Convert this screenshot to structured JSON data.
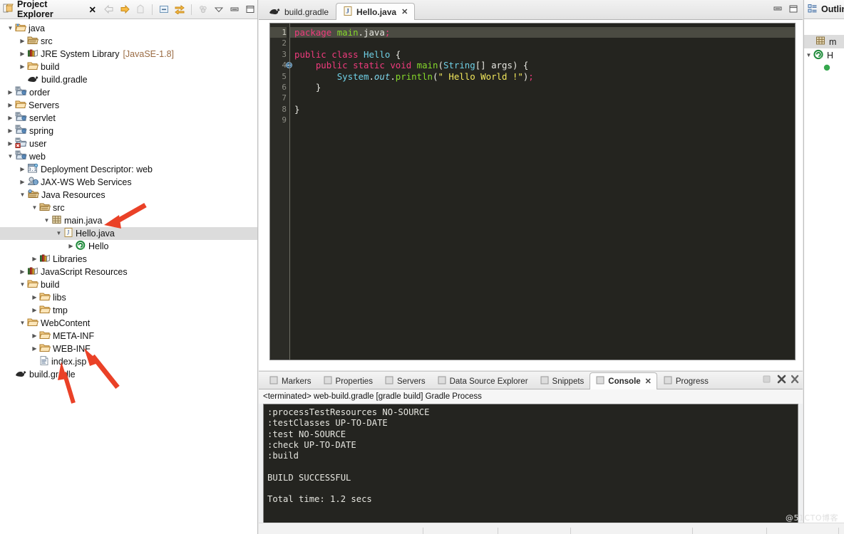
{
  "colors": {
    "accent_red": "#ea4127",
    "selection_gray": "#dcdcdc",
    "editor_bg": "#24241f",
    "console_bg": "#242420",
    "keyword_pink": "#ef3b7d",
    "type_cyan": "#6fd0e6",
    "method_green": "#86d92b",
    "string_yellow": "#f2e85c"
  },
  "project_explorer": {
    "title": "Project Explorer",
    "close_glyph": "✕",
    "toolbar": [
      {
        "name": "back-icon",
        "glyph": "⇦",
        "enabled": false
      },
      {
        "name": "forward-icon",
        "glyph": "⇨",
        "enabled": true
      },
      {
        "name": "up-icon",
        "glyph": "⇧",
        "enabled": false
      },
      {
        "name": "collapse-all-icon",
        "glyph": "⊟",
        "enabled": true
      },
      {
        "name": "link-with-editor-icon",
        "glyph": "⇄",
        "enabled": true
      },
      {
        "name": "focus-on-active-task-icon",
        "glyph": "⁘",
        "enabled": false
      },
      {
        "name": "view-menu-icon",
        "glyph": "▽",
        "enabled": true
      },
      {
        "name": "minimize-icon",
        "glyph": "▬",
        "enabled": true
      },
      {
        "name": "maximize-icon",
        "glyph": "❐",
        "enabled": true
      }
    ],
    "tree": [
      {
        "indent": 0,
        "twist": "▼",
        "icon": "project-open-folder-icon",
        "label": "java",
        "extra": "",
        "selected": false
      },
      {
        "indent": 1,
        "twist": "▶",
        "icon": "source-folder-icon",
        "label": "src",
        "extra": "",
        "selected": false
      },
      {
        "indent": 1,
        "twist": "▶",
        "icon": "library-icon",
        "label": "JRE System Library",
        "extra": "[JavaSE-1.8]",
        "selected": false
      },
      {
        "indent": 1,
        "twist": "▶",
        "icon": "folder-icon",
        "label": "build",
        "extra": "",
        "selected": false
      },
      {
        "indent": 1,
        "twist": "",
        "icon": "gradle-icon",
        "label": "build.gradle",
        "extra": "",
        "selected": false
      },
      {
        "indent": 0,
        "twist": "▶",
        "icon": "web-project-icon",
        "label": "order",
        "extra": "",
        "selected": false
      },
      {
        "indent": 0,
        "twist": "▶",
        "icon": "folder-icon",
        "label": "Servers",
        "extra": "",
        "selected": false
      },
      {
        "indent": 0,
        "twist": "▶",
        "icon": "web-project-icon",
        "label": "servlet",
        "extra": "",
        "selected": false
      },
      {
        "indent": 0,
        "twist": "▶",
        "icon": "web-project-icon",
        "label": "spring",
        "extra": "",
        "selected": false
      },
      {
        "indent": 0,
        "twist": "▶",
        "icon": "web-project-error-icon",
        "label": "user",
        "extra": "",
        "selected": false
      },
      {
        "indent": 0,
        "twist": "▼",
        "icon": "web-project-icon",
        "label": "web",
        "extra": "",
        "selected": false
      },
      {
        "indent": 1,
        "twist": "▶",
        "icon": "deployment-descriptor-icon",
        "label": "Deployment Descriptor: web",
        "extra": "",
        "selected": false
      },
      {
        "indent": 1,
        "twist": "▶",
        "icon": "jaxws-icon",
        "label": "JAX-WS Web Services",
        "extra": "",
        "selected": false
      },
      {
        "indent": 1,
        "twist": "▼",
        "icon": "java-resources-icon",
        "label": "Java Resources",
        "extra": "",
        "selected": false
      },
      {
        "indent": 2,
        "twist": "▼",
        "icon": "source-folder-icon",
        "label": "src",
        "extra": "",
        "selected": false
      },
      {
        "indent": 3,
        "twist": "▼",
        "icon": "package-icon",
        "label": "main.java",
        "extra": "",
        "selected": false
      },
      {
        "indent": 4,
        "twist": "▼",
        "icon": "java-file-icon",
        "label": "Hello.java",
        "extra": "",
        "selected": true
      },
      {
        "indent": 5,
        "twist": "▶",
        "icon": "class-icon",
        "label": "Hello",
        "extra": "",
        "selected": false
      },
      {
        "indent": 2,
        "twist": "▶",
        "icon": "library-icon",
        "label": "Libraries",
        "extra": "",
        "selected": false
      },
      {
        "indent": 1,
        "twist": "▶",
        "icon": "library-icon",
        "label": "JavaScript Resources",
        "extra": "",
        "selected": false
      },
      {
        "indent": 1,
        "twist": "▼",
        "icon": "folder-icon",
        "label": "build",
        "extra": "",
        "selected": false
      },
      {
        "indent": 2,
        "twist": "▶",
        "icon": "folder-icon",
        "label": "libs",
        "extra": "",
        "selected": false
      },
      {
        "indent": 2,
        "twist": "▶",
        "icon": "folder-icon",
        "label": "tmp",
        "extra": "",
        "selected": false
      },
      {
        "indent": 1,
        "twist": "▼",
        "icon": "folder-icon",
        "label": "WebContent",
        "extra": "",
        "selected": false
      },
      {
        "indent": 2,
        "twist": "▶",
        "icon": "folder-icon",
        "label": "META-INF",
        "extra": "",
        "selected": false
      },
      {
        "indent": 2,
        "twist": "▶",
        "icon": "folder-icon",
        "label": "WEB-INF",
        "extra": "",
        "selected": false
      },
      {
        "indent": 2,
        "twist": "",
        "icon": "jsp-file-icon",
        "label": "index.jsp",
        "extra": "",
        "selected": false
      },
      {
        "indent": 0,
        "twist": "",
        "icon": "gradle-icon",
        "label": "build.gradle",
        "extra": "",
        "selected": false
      }
    ]
  },
  "editor": {
    "tabs": [
      {
        "name": "tab-build-gradle",
        "icon": "gradle-icon",
        "label": "build.gradle",
        "active": false,
        "closable": false
      },
      {
        "name": "tab-hello-java",
        "icon": "java-file-icon",
        "label": "Hello.java",
        "active": true,
        "closable": true
      }
    ],
    "close_glyph": "✕",
    "window_buttons": [
      {
        "name": "minimize-icon",
        "glyph": "▬"
      },
      {
        "name": "maximize-icon",
        "glyph": "❐"
      }
    ],
    "line_numbers": [
      "1",
      "2",
      "3",
      "4",
      "5",
      "6",
      "7",
      "8",
      "9"
    ],
    "breakpoint_line": 4,
    "current_line": 1,
    "code_lines": [
      "package main.java;",
      "",
      "public class Hello {",
      "    public static void main(String[] args) {",
      "        System.out.println(\" Hello World !\");",
      "    }",
      "",
      "}",
      ""
    ]
  },
  "console": {
    "tabs": [
      {
        "name": "tab-markers",
        "icon": "markers-icon",
        "label": "Markers",
        "active": false
      },
      {
        "name": "tab-properties",
        "icon": "properties-icon",
        "label": "Properties",
        "active": false
      },
      {
        "name": "tab-servers",
        "icon": "servers-icon",
        "label": "Servers",
        "active": false
      },
      {
        "name": "tab-data-source-explorer",
        "icon": "data-source-icon",
        "label": "Data Source Explorer",
        "active": false
      },
      {
        "name": "tab-snippets",
        "icon": "snippets-icon",
        "label": "Snippets",
        "active": false
      },
      {
        "name": "tab-console",
        "icon": "console-icon",
        "label": "Console",
        "active": true
      },
      {
        "name": "tab-progress",
        "icon": "progress-icon",
        "label": "Progress",
        "active": false
      }
    ],
    "close_glyph": "✕",
    "toolbar": [
      {
        "name": "terminate-icon",
        "glyph": "■",
        "enabled": false
      },
      {
        "name": "remove-launch-icon",
        "glyph": "✖",
        "enabled": true
      },
      {
        "name": "remove-all-terminated-icon",
        "glyph": "✖",
        "enabled": true
      }
    ],
    "subtitle": "<terminated> web-build.gradle [gradle build] Gradle Process",
    "output": ":processTestResources NO-SOURCE\n:testClasses UP-TO-DATE\n:test NO-SOURCE\n:check UP-TO-DATE\n:build\n\nBUILD SUCCESSFUL\n\nTotal time: 1.2 secs"
  },
  "outline": {
    "title": "Outline",
    "items": [
      {
        "icon": "package-icon",
        "label": "m",
        "twist": "",
        "selected": true
      },
      {
        "icon": "class-icon",
        "label": "H",
        "twist": "▼",
        "selected": false
      },
      {
        "icon": "method-icon",
        "label": "",
        "twist": "",
        "selected": false
      }
    ]
  },
  "annotations": [
    {
      "name": "arrow-to-hello-java",
      "target": "Hello.java"
    },
    {
      "name": "arrow-to-index-jsp",
      "target": "index.jsp"
    },
    {
      "name": "arrow-to-build-gradle",
      "target": "build.gradle"
    }
  ],
  "watermark": "@51CTO博客"
}
